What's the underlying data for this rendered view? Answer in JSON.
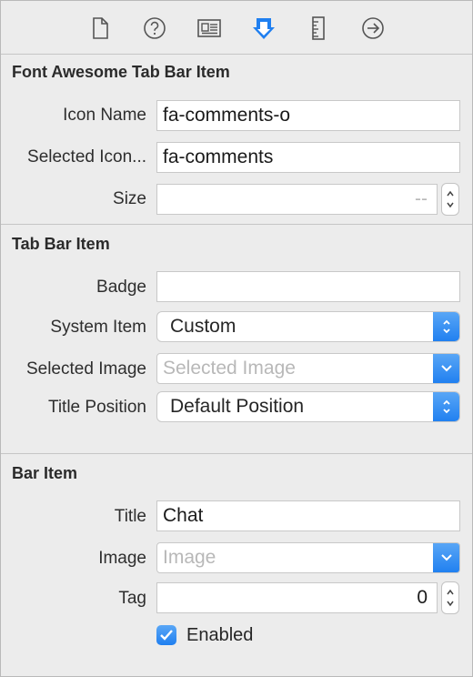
{
  "toolbar": {
    "icons": [
      "file-icon",
      "help-icon",
      "identity-icon",
      "attributes-icon",
      "ruler-icon",
      "connections-icon"
    ],
    "accent": "#1f7ff0"
  },
  "fa_section": {
    "title": "Font Awesome Tab Bar Item",
    "icon_name_label": "Icon Name",
    "icon_name_value": "fa-comments-o",
    "selected_icon_label": "Selected Icon...",
    "selected_icon_value": "fa-comments",
    "size_label": "Size",
    "size_placeholder": "--"
  },
  "tab_bar_section": {
    "title": "Tab Bar Item",
    "badge_label": "Badge",
    "badge_value": "",
    "system_item_label": "System Item",
    "system_item_value": "Custom",
    "selected_image_label": "Selected Image",
    "selected_image_placeholder": "Selected Image",
    "title_position_label": "Title Position",
    "title_position_value": "Default Position"
  },
  "bar_item_section": {
    "title": "Bar Item",
    "title_label": "Title",
    "title_value": "Chat",
    "image_label": "Image",
    "image_placeholder": "Image",
    "tag_label": "Tag",
    "tag_value": "0",
    "enabled_label": "Enabled",
    "enabled_checked": true
  }
}
